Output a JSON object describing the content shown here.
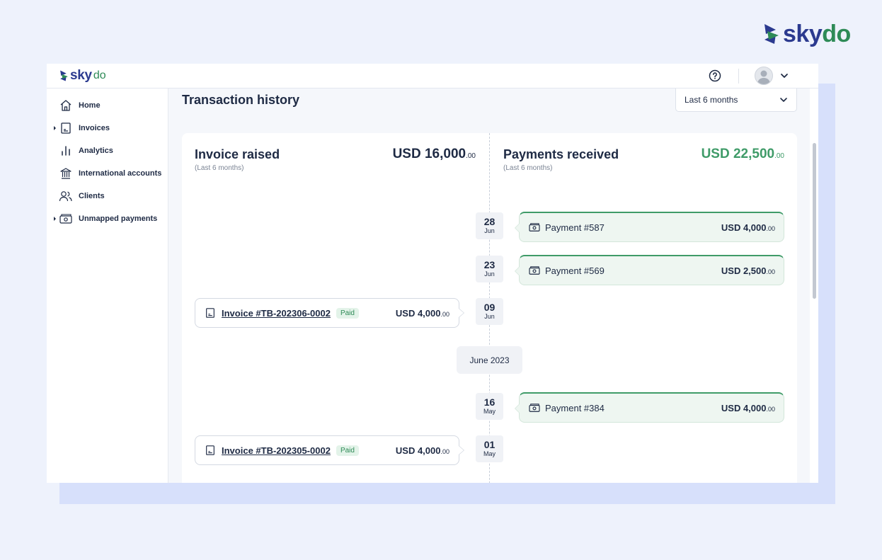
{
  "brand": {
    "logo_text": "skydo"
  },
  "topbar": {
    "logo_text": "skydo"
  },
  "sidebar": {
    "items": [
      {
        "label": "Home",
        "icon": "home-icon",
        "expandable": false
      },
      {
        "label": "Invoices",
        "icon": "invoice-icon",
        "expandable": true
      },
      {
        "label": "Analytics",
        "icon": "analytics-icon",
        "expandable": false
      },
      {
        "label": "International accounts",
        "icon": "bank-icon",
        "expandable": false
      },
      {
        "label": "Clients",
        "icon": "users-icon",
        "expandable": false
      },
      {
        "label": "Unmapped payments",
        "icon": "cash-icon",
        "expandable": true
      }
    ]
  },
  "main": {
    "title": "Transaction history",
    "range_select": {
      "selected": "Last 6 months"
    },
    "invoice_summary": {
      "title": "Invoice raised",
      "subtitle": "(Last 6 months)",
      "amount": "USD 16,000",
      "cents": ".00"
    },
    "payment_summary": {
      "title": "Payments received",
      "subtitle": "(Last 6 months)",
      "amount": "USD 22,500",
      "cents": ".00"
    },
    "dates": [
      {
        "day": "28",
        "month": "Jun"
      },
      {
        "day": "23",
        "month": "Jun"
      },
      {
        "day": "09",
        "month": "Jun"
      },
      {
        "day": "16",
        "month": "May"
      },
      {
        "day": "01",
        "month": "May"
      }
    ],
    "month_separator": "June 2023",
    "payments": [
      {
        "title": "Payment #587",
        "amount": "USD 4,000",
        "cents": ".00"
      },
      {
        "title": "Payment #569",
        "amount": "USD 2,500",
        "cents": ".00"
      },
      {
        "title": "Payment #384",
        "amount": "USD 4,000",
        "cents": ".00"
      }
    ],
    "invoices": [
      {
        "title": "Invoice #TB-202306-0002",
        "status": "Paid",
        "amount": "USD 4,000",
        "cents": ".00"
      },
      {
        "title": "Invoice #TB-202305-0002",
        "status": "Paid",
        "amount": "USD 4,000",
        "cents": ".00"
      }
    ]
  },
  "colors": {
    "brand_blue": "#2b3a8f",
    "brand_green": "#2e8b57",
    "payment_green": "#3f9b68",
    "text_dark": "#1e2a44"
  }
}
